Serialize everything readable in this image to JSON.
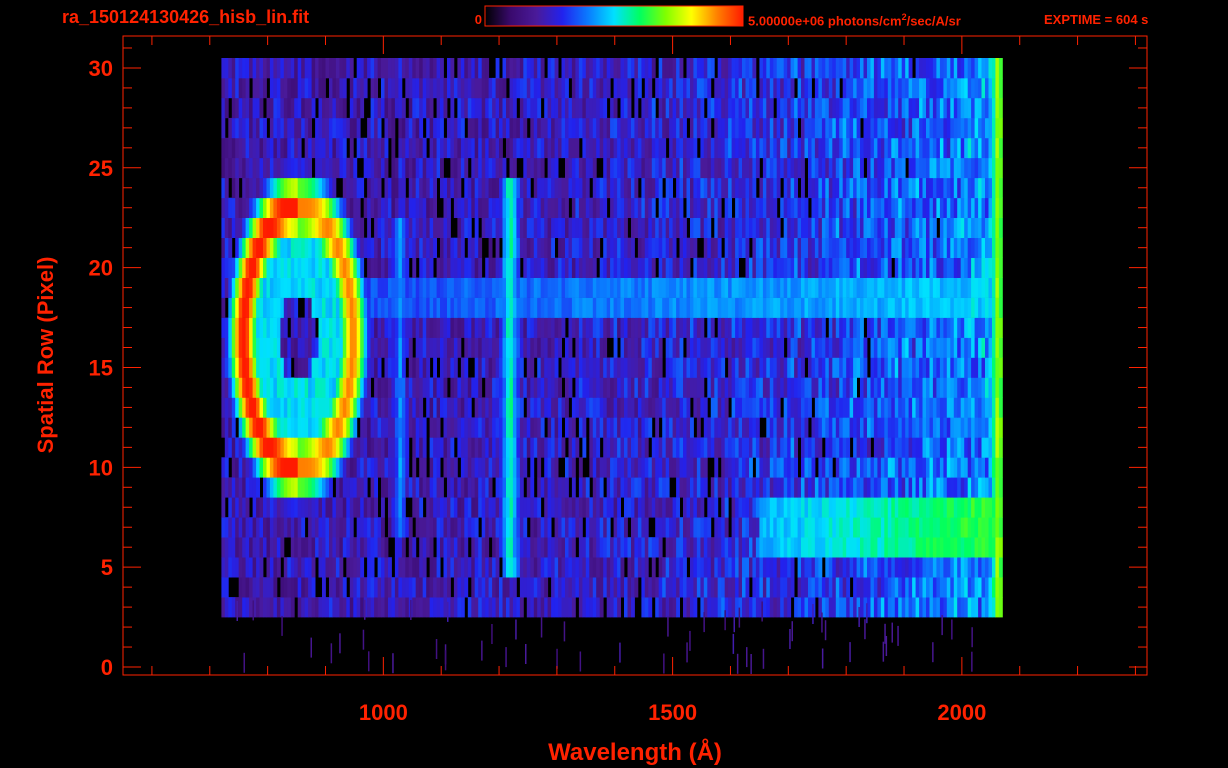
{
  "header": {
    "filename": "ra_150124130426_hisb_lin.fit",
    "colorbar_min_label": "0",
    "colorbar_max_value": "5.00000e+06 photons/cm",
    "colorbar_max_exponent": "2",
    "colorbar_max_unit": "/sec/A/sr",
    "exptime": "EXPTIME = 604 s"
  },
  "colors": {
    "axis": "#ff2200",
    "background": "#000000",
    "colormap": [
      "#000000",
      "#3a0a6e",
      "#4a1a9a",
      "#2222ee",
      "#0a7cff",
      "#00e0ff",
      "#00ff60",
      "#80ff00",
      "#ffff00",
      "#ff8000",
      "#ff1a00"
    ]
  },
  "chart_data": {
    "type": "heatmap",
    "xlabel": "Wavelength (Å)",
    "ylabel": "Spatial Row (Pixel)",
    "xlim": [
      550,
      2320
    ],
    "ylim": [
      -0.4,
      31.6
    ],
    "x_ticks": [
      1000,
      1500,
      2000
    ],
    "y_ticks": [
      0,
      5,
      10,
      15,
      20,
      25,
      30
    ],
    "x_minor_step": 100,
    "y_minor_step": 1,
    "data_extent_x": [
      720,
      2065
    ],
    "data_extent_y": [
      3,
      30
    ],
    "colorbar": {
      "min": 0,
      "max": 5000000
    },
    "features": [
      {
        "kind": "emission-line",
        "x": 1216,
        "rows": [
          5,
          24
        ],
        "level": 0.55
      },
      {
        "kind": "emission-line",
        "x": 1026,
        "rows": [
          7,
          22
        ],
        "level": 0.38
      },
      {
        "kind": "emission-line",
        "x": 2060,
        "rows": [
          0,
          30
        ],
        "level": 0.72
      },
      {
        "kind": "continuum-band",
        "x_range": [
          950,
          2065
        ],
        "rows": [
          18,
          19.5
        ],
        "level": 0.4
      },
      {
        "kind": "continuum-band",
        "x_range": [
          1650,
          2065
        ],
        "rows": [
          6,
          8
        ],
        "level": 0.55
      },
      {
        "kind": "ring",
        "x_center": 850,
        "row_center": 16.5,
        "x_radius": 95,
        "row_radius": 6.5,
        "level": 0.9
      }
    ]
  }
}
